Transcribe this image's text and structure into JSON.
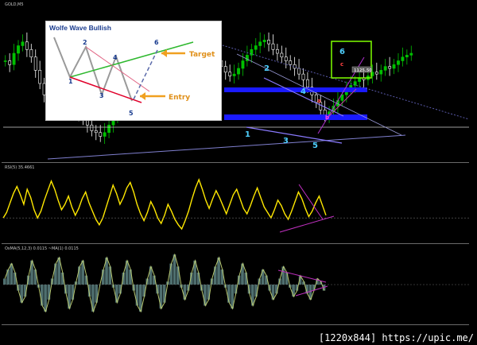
{
  "header": {
    "symbol_line": "GOLD,M5",
    "rsi_label": "RSI(5) 35.4661",
    "osma_label": "OsMA(5,12,3) 0.0115   ~MA(1) 0.0115"
  },
  "inset": {
    "title": "Wolfe Wave Bullish",
    "points": [
      "1",
      "2",
      "3",
      "4",
      "5",
      "6"
    ],
    "target_label": "Target",
    "entry_label": "Entry"
  },
  "annotations": {
    "wave_points": [
      "1",
      "2",
      "3",
      "4",
      "5"
    ],
    "target_point": "6",
    "letters": [
      "a",
      "b",
      "c"
    ],
    "price_tag": "1125.50"
  },
  "credit": "[1220x844] https://upic.me/",
  "colors": {
    "background": "#000000",
    "bull_candle": "#00c000",
    "bear_candle": "#ffffff",
    "rsi_line": "#ffe800",
    "osma_line": "#b8c870",
    "zone": "#1a1aff",
    "wave_line": "#8a7aff",
    "target_box": "#7fff00",
    "label_cyan": "#4fd0ff",
    "inset_green": "#2eb82e",
    "inset_red": "#e0002a",
    "inset_arrow": "#f0a020"
  },
  "chart_data": [
    {
      "type": "line",
      "panel": "price",
      "series": [
        {
          "values": [
            52,
            50,
            56,
            60,
            62,
            58,
            54,
            47,
            40,
            34,
            30,
            33,
            38,
            41,
            37,
            32,
            28,
            24,
            21,
            18,
            15,
            14,
            12,
            14,
            18,
            22,
            26,
            30,
            34,
            38,
            41,
            44,
            40,
            36,
            33,
            30,
            28,
            27,
            29,
            32,
            37,
            42,
            47,
            52,
            56,
            59,
            61,
            58,
            55,
            52,
            49,
            46,
            44,
            45,
            48,
            52,
            55,
            58,
            60,
            62,
            63,
            61,
            58,
            56,
            54,
            52,
            50,
            48,
            45,
            42,
            38,
            34,
            30,
            26,
            23,
            25,
            28,
            31,
            34,
            37,
            39,
            41,
            43,
            42,
            44,
            46,
            45,
            47,
            49,
            48,
            50,
            52,
            54,
            55,
            56
          ]
        }
      ]
    },
    {
      "type": "line",
      "panel": "rsi",
      "series": [
        {
          "values": [
            30,
            38,
            52,
            66,
            76,
            64,
            50,
            72,
            60,
            42,
            30,
            40,
            56,
            70,
            84,
            72,
            56,
            42,
            50,
            62,
            46,
            34,
            44,
            58,
            68,
            52,
            40,
            28,
            20,
            30,
            46,
            62,
            78,
            66,
            50,
            60,
            74,
            82,
            68,
            50,
            36,
            26,
            38,
            54,
            44,
            30,
            22,
            34,
            50,
            40,
            28,
            20,
            14,
            26,
            40,
            58,
            74,
            86,
            72,
            56,
            44,
            58,
            70,
            60,
            48,
            36,
            50,
            64,
            72,
            58,
            44,
            36,
            48,
            62,
            74,
            60,
            46,
            38,
            30,
            42,
            56,
            48,
            36,
            28,
            40,
            54,
            68,
            58,
            44,
            32,
            40,
            52,
            62,
            48,
            34
          ]
        }
      ]
    },
    {
      "type": "area",
      "panel": "osma",
      "series": [
        {
          "values": [
            0.2,
            0.5,
            0.7,
            0.4,
            -0.2,
            -0.6,
            -0.4,
            0.3,
            0.8,
            0.5,
            -0.1,
            -0.7,
            -0.9,
            -0.5,
            0.2,
            0.7,
            0.9,
            0.4,
            -0.3,
            -0.8,
            -0.5,
            0.1,
            0.6,
            0.8,
            0.3,
            -0.4,
            -0.9,
            -0.6,
            0.0,
            0.5,
            0.9,
            0.6,
            -0.1,
            -0.6,
            -0.3,
            0.4,
            0.8,
            0.5,
            -0.2,
            -0.7,
            -0.9,
            -0.4,
            0.2,
            0.6,
            0.3,
            -0.3,
            -0.8,
            -0.6,
            0.1,
            0.7,
            1.0,
            0.6,
            -0.1,
            -0.5,
            -0.2,
            0.4,
            0.8,
            0.4,
            -0.2,
            -0.7,
            -0.5,
            0.2,
            0.6,
            0.9,
            0.5,
            -0.1,
            -0.6,
            -0.8,
            -0.3,
            0.3,
            0.7,
            0.4,
            -0.3,
            -0.7,
            -0.4,
            0.2,
            0.5,
            0.3,
            -0.2,
            -0.5,
            -0.3,
            0.2,
            0.6,
            0.4,
            -0.1,
            -0.4,
            -0.2,
            0.3,
            0.1,
            -0.3,
            -0.5,
            -0.2,
            0.2,
            0.1,
            -0.2
          ]
        }
      ]
    }
  ]
}
